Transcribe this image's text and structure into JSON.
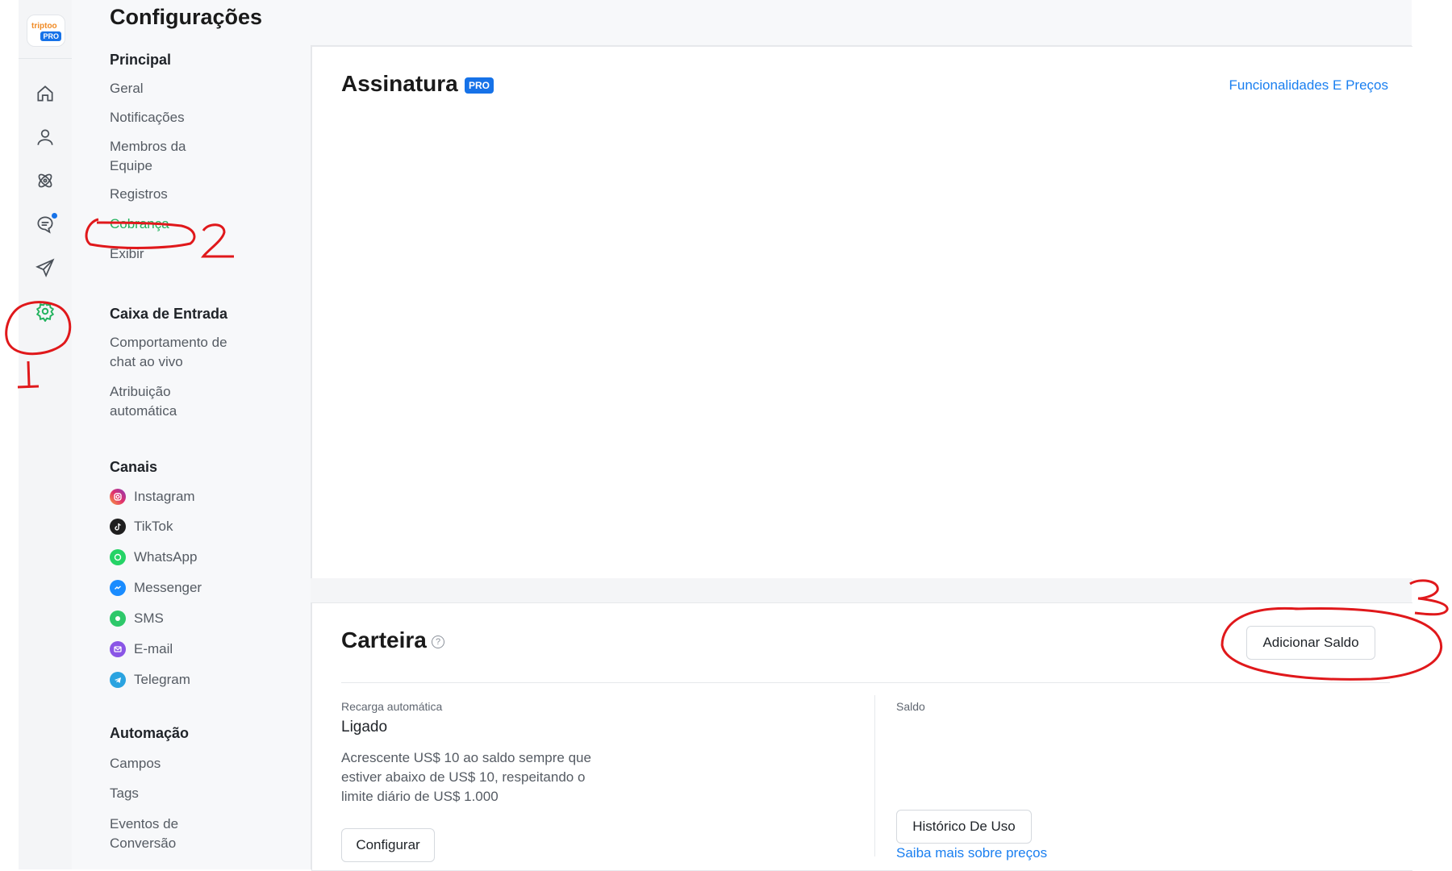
{
  "logo": {
    "text": "triptoo",
    "badge": "PRO"
  },
  "rail": {
    "icons": [
      "home-icon",
      "user-icon",
      "integrations-icon",
      "chat-icon",
      "send-icon",
      "gear-icon"
    ]
  },
  "settings_menu": {
    "title": "Configurações",
    "sections": {
      "principal": {
        "label": "Principal",
        "items": [
          "Geral",
          "Notificações",
          "Membros da Equipe",
          "Registros",
          "Cobrança",
          "Exibir"
        ]
      },
      "inbox": {
        "label": "Caixa de Entrada",
        "items": [
          "Comportamento de chat ao vivo",
          "Atribuição automática"
        ]
      },
      "channels": {
        "label": "Canais",
        "items": [
          "Instagram",
          "TikTok",
          "WhatsApp",
          "Messenger",
          "SMS",
          "E-mail",
          "Telegram"
        ]
      },
      "automation": {
        "label": "Automação",
        "items": [
          "Campos",
          "Tags",
          "Eventos de Conversão"
        ]
      }
    },
    "active_item": "Cobrança"
  },
  "subscription": {
    "title": "Assinatura",
    "badge": "PRO",
    "link": "Funcionalidades E Preços"
  },
  "wallet": {
    "title": "Carteira",
    "add_button": "Adicionar Saldo",
    "auto_recharge_label": "Recarga automática",
    "auto_recharge_value": "Ligado",
    "auto_recharge_desc": "Acrescente US$ 10 ao saldo sempre que estiver abaixo de US$ 10, respeitando o limite diário de US$ 1.000",
    "configure_button": "Configurar",
    "balance_label": "Saldo",
    "history_button": "Histórico De Uso",
    "pricing_link": "Saiba mais sobre preços"
  },
  "annotations": {
    "one": "1",
    "two": "2",
    "three": "3"
  },
  "colors": {
    "accent_green": "#22b35e",
    "link_blue": "#1a7ff0",
    "pro_blue": "#1672e8",
    "annotation_red": "#e0181b"
  }
}
